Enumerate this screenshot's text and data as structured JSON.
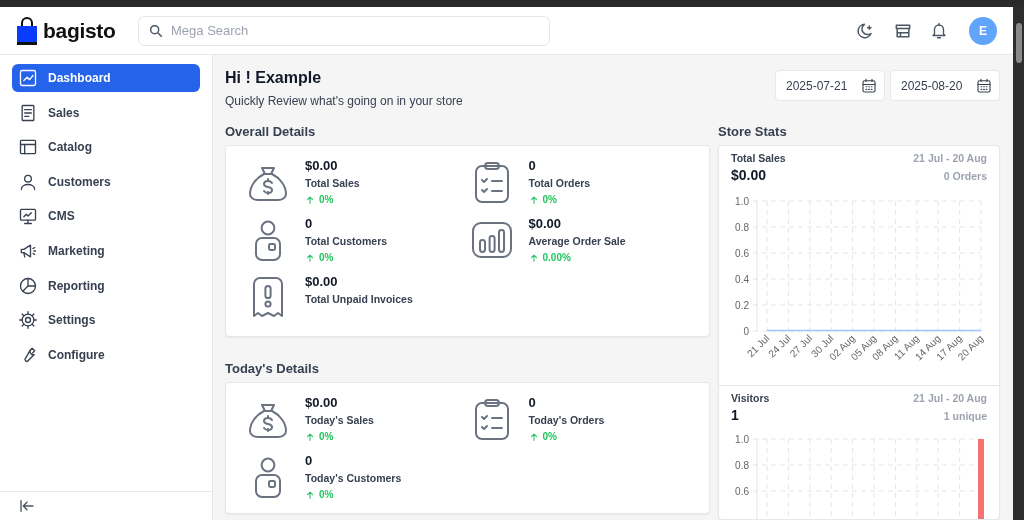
{
  "header": {
    "logo": "bagisto",
    "search": {
      "placeholder": "Mega Search"
    },
    "avatar": "E"
  },
  "sidebar": {
    "items": [
      {
        "label": "Dashboard",
        "kind": "dashboard",
        "selected": true
      },
      {
        "label": "Sales",
        "kind": "sales",
        "selected": false
      },
      {
        "label": "Catalog",
        "kind": "catalog",
        "selected": false
      },
      {
        "label": "Customers",
        "kind": "customers",
        "selected": false
      },
      {
        "label": "CMS",
        "kind": "cms",
        "selected": false
      },
      {
        "label": "Marketing",
        "kind": "marketing",
        "selected": false
      },
      {
        "label": "Reporting",
        "kind": "reporting",
        "selected": false
      },
      {
        "label": "Settings",
        "kind": "settings",
        "selected": false
      },
      {
        "label": "Configure",
        "kind": "configure",
        "selected": false
      }
    ]
  },
  "greeting": {
    "title": "Hi ! Example",
    "subtitle": "Quickly Review what's going on in your store"
  },
  "date_range": {
    "start": "2025-07-21",
    "end": "2025-08-20"
  },
  "overall_details": {
    "title": "Overall Details",
    "stats": [
      {
        "kind": "sales",
        "value": "$0.00",
        "label": "Total Sales",
        "change": "0%"
      },
      {
        "kind": "orders",
        "value": "0",
        "label": "Total Orders",
        "change": "0%"
      },
      {
        "kind": "customers",
        "value": "0",
        "label": "Total Customers",
        "change": "0%"
      },
      {
        "kind": "average",
        "value": "$0.00",
        "label": "Average Order Sale",
        "change": "0.00%"
      },
      {
        "kind": "invoices",
        "value": "$0.00",
        "label": "Total Unpaid Invoices"
      }
    ]
  },
  "todays_details": {
    "title": "Today's Details",
    "stats": [
      {
        "kind": "sales",
        "value": "$0.00",
        "label": "Today's Sales",
        "change": "0%"
      },
      {
        "kind": "orders",
        "value": "0",
        "label": "Today's Orders",
        "change": "0%"
      },
      {
        "kind": "customers",
        "value": "0",
        "label": "Today's Customers",
        "change": "0%"
      }
    ]
  },
  "store_stats": {
    "title": "Store Stats",
    "panels": [
      {
        "title": "Total Sales",
        "value": "$0.00",
        "range": "21 Jul - 20 Aug",
        "note": "0 Orders",
        "chart_data": {
          "type": "line",
          "categories": [
            "21 Jul",
            "24 Jul",
            "27 Jul",
            "30 Jul",
            "02 Aug",
            "05 Aug",
            "08 Aug",
            "11 Aug",
            "14 Aug",
            "17 Aug",
            "20 Aug"
          ],
          "grid": true,
          "series": [
            {
              "color": "#9ec5fe",
              "values": [
                0,
                0,
                0,
                0,
                0,
                0,
                0,
                0,
                0,
                0,
                0
              ]
            }
          ],
          "ylim": [
            0,
            1
          ],
          "yticks": [
            {
              "value": 0,
              "label": "0"
            },
            {
              "value": 0.2,
              "label": "0.2"
            },
            {
              "value": 0.4,
              "label": "0.4"
            },
            {
              "value": 0.6,
              "label": "0.6"
            },
            {
              "value": 0.8,
              "label": "0.8"
            },
            {
              "value": 1,
              "label": "1.0"
            }
          ]
        }
      },
      {
        "title": "Visitors",
        "value": "1",
        "range": "21 Jul - 20 Aug",
        "note": "1 unique",
        "chart_data": {
          "type": "bar",
          "grid": true,
          "series": [
            {
              "color": "#f87171",
              "values": [
                0,
                0,
                0,
                0,
                0,
                0,
                0,
                0,
                0,
                0,
                1
              ]
            }
          ],
          "ylim": [
            0,
            1
          ],
          "yticks": [
            {
              "value": 0.6,
              "label": "0.6"
            },
            {
              "value": 0.8,
              "label": "0.8"
            },
            {
              "value": 1,
              "label": "1.0"
            }
          ]
        }
      }
    ]
  }
}
